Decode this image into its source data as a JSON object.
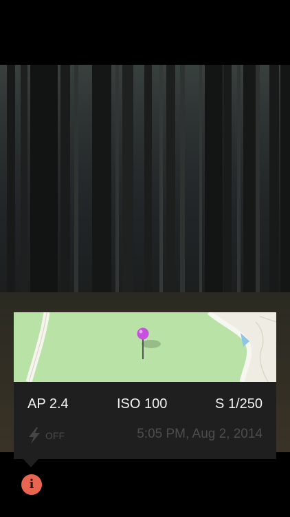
{
  "photo": {
    "subject": "forest-photo"
  },
  "map": {
    "pin_color": "#c84fe0"
  },
  "exif": {
    "aperture": "AP 2.4",
    "iso": "ISO 100",
    "shutter": "S 1/250"
  },
  "meta": {
    "flash_label": "OFF",
    "datetime": "5:05 PM, Aug 2, 2014"
  },
  "info_button": {
    "glyph": "i",
    "color": "#ea6550"
  }
}
